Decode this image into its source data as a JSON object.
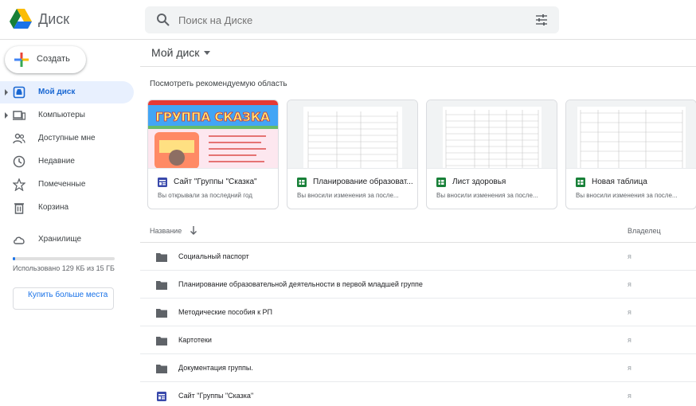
{
  "header": {
    "app_name": "Диск",
    "search_placeholder": "Поиск на Диске"
  },
  "sidebar": {
    "create_label": "Создать",
    "items": [
      {
        "label": "Мой диск",
        "icon": "drive-icon"
      },
      {
        "label": "Компьютеры",
        "icon": "computer-icon"
      },
      {
        "label": "Доступные мне",
        "icon": "shared-icon"
      },
      {
        "label": "Недавние",
        "icon": "clock-icon"
      },
      {
        "label": "Помеченные",
        "icon": "star-icon"
      },
      {
        "label": "Корзина",
        "icon": "trash-icon"
      },
      {
        "label": "Хранилище",
        "icon": "cloud-icon"
      }
    ],
    "storage_text": "Использовано 129 КБ из 15 ГБ",
    "storage_fraction": 0.01,
    "buy_label": "Купить больше места"
  },
  "main": {
    "title": "Мой диск",
    "suggested_heading": "Посмотреть рекомендуемую область",
    "cards": [
      {
        "name": "Сайт \"Группы \"Сказка\"",
        "subtitle": "Вы открывали за последний год",
        "icon": "sites-icon",
        "thumb_title": "ГРУППА СКАЗКА"
      },
      {
        "name": "Планирование образоват...",
        "subtitle": "Вы вносили изменения за после...",
        "icon": "sheets-icon"
      },
      {
        "name": "Лист здоровья",
        "subtitle": "Вы вносили изменения за после...",
        "icon": "sheets-icon"
      },
      {
        "name": "Новая таблица",
        "subtitle": "Вы вносили изменения за после...",
        "icon": "sheets-icon"
      }
    ],
    "columns": {
      "name": "Название",
      "owner": "Владелец"
    },
    "rows": [
      {
        "name": "Социальный паспорт",
        "owner": "я",
        "icon": "folder-icon"
      },
      {
        "name": "Планирование образовательной деятельности в первой младшей группе",
        "owner": "я",
        "icon": "folder-icon"
      },
      {
        "name": "Методические пособия к РП",
        "owner": "я",
        "icon": "folder-icon"
      },
      {
        "name": "Картотеки",
        "owner": "я",
        "icon": "folder-icon"
      },
      {
        "name": "Документация группы.",
        "owner": "я",
        "icon": "folder-icon"
      },
      {
        "name": "Сайт \"Группы \"Сказка\"",
        "owner": "я",
        "icon": "sites-icon"
      }
    ]
  },
  "colors": {
    "accent": "#1a73e8",
    "active_bg": "#e8f0fe",
    "sheets_green": "#188038",
    "sites_blue": "#3949ab",
    "folder_gray": "#5f6368"
  }
}
